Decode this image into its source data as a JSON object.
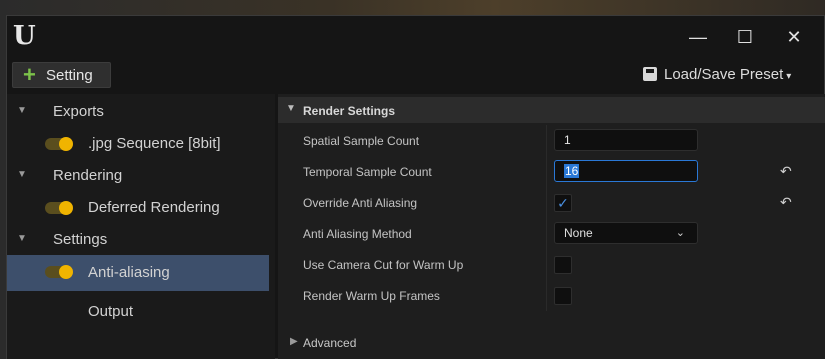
{
  "window": {
    "logo_glyph": "U",
    "controls": {
      "minimize": "—",
      "maximize": "☐",
      "close": "✕"
    }
  },
  "toolbar": {
    "add_icon": "+",
    "add_label": "Setting",
    "preset_label": "Load/Save Preset",
    "preset_caret": "▾"
  },
  "sidebar": {
    "items": [
      {
        "label": "Exports",
        "kind": "group"
      },
      {
        "label": ".jpg Sequence [8bit]",
        "kind": "item",
        "enabled": true
      },
      {
        "label": "Rendering",
        "kind": "group"
      },
      {
        "label": "Deferred Rendering",
        "kind": "item",
        "enabled": true
      },
      {
        "label": "Settings",
        "kind": "group"
      },
      {
        "label": "Anti-aliasing",
        "kind": "item",
        "enabled": true,
        "selected": true
      },
      {
        "label": "Output",
        "kind": "item"
      }
    ]
  },
  "details": {
    "section_title": "Render Settings",
    "properties": [
      {
        "label": "Spatial Sample Count",
        "value": "1"
      },
      {
        "label": "Temporal Sample Count",
        "value": "16"
      },
      {
        "label": "Override Anti Aliasing",
        "checked": true
      },
      {
        "label": "Anti Aliasing Method",
        "value": "None"
      },
      {
        "label": "Use Camera Cut for Warm Up",
        "checked": false
      },
      {
        "label": "Render Warm Up Frames",
        "checked": false
      }
    ],
    "advanced_label": "Advanced",
    "check_glyph": "✓",
    "reset_glyph": "↶",
    "chevron_glyph": "⌄"
  },
  "colors": {
    "accent_blue": "#2a78d6",
    "toggle_yellow": "#f0b400",
    "add_green": "#7cc24a",
    "selection_bg": "#3d4f6b"
  }
}
